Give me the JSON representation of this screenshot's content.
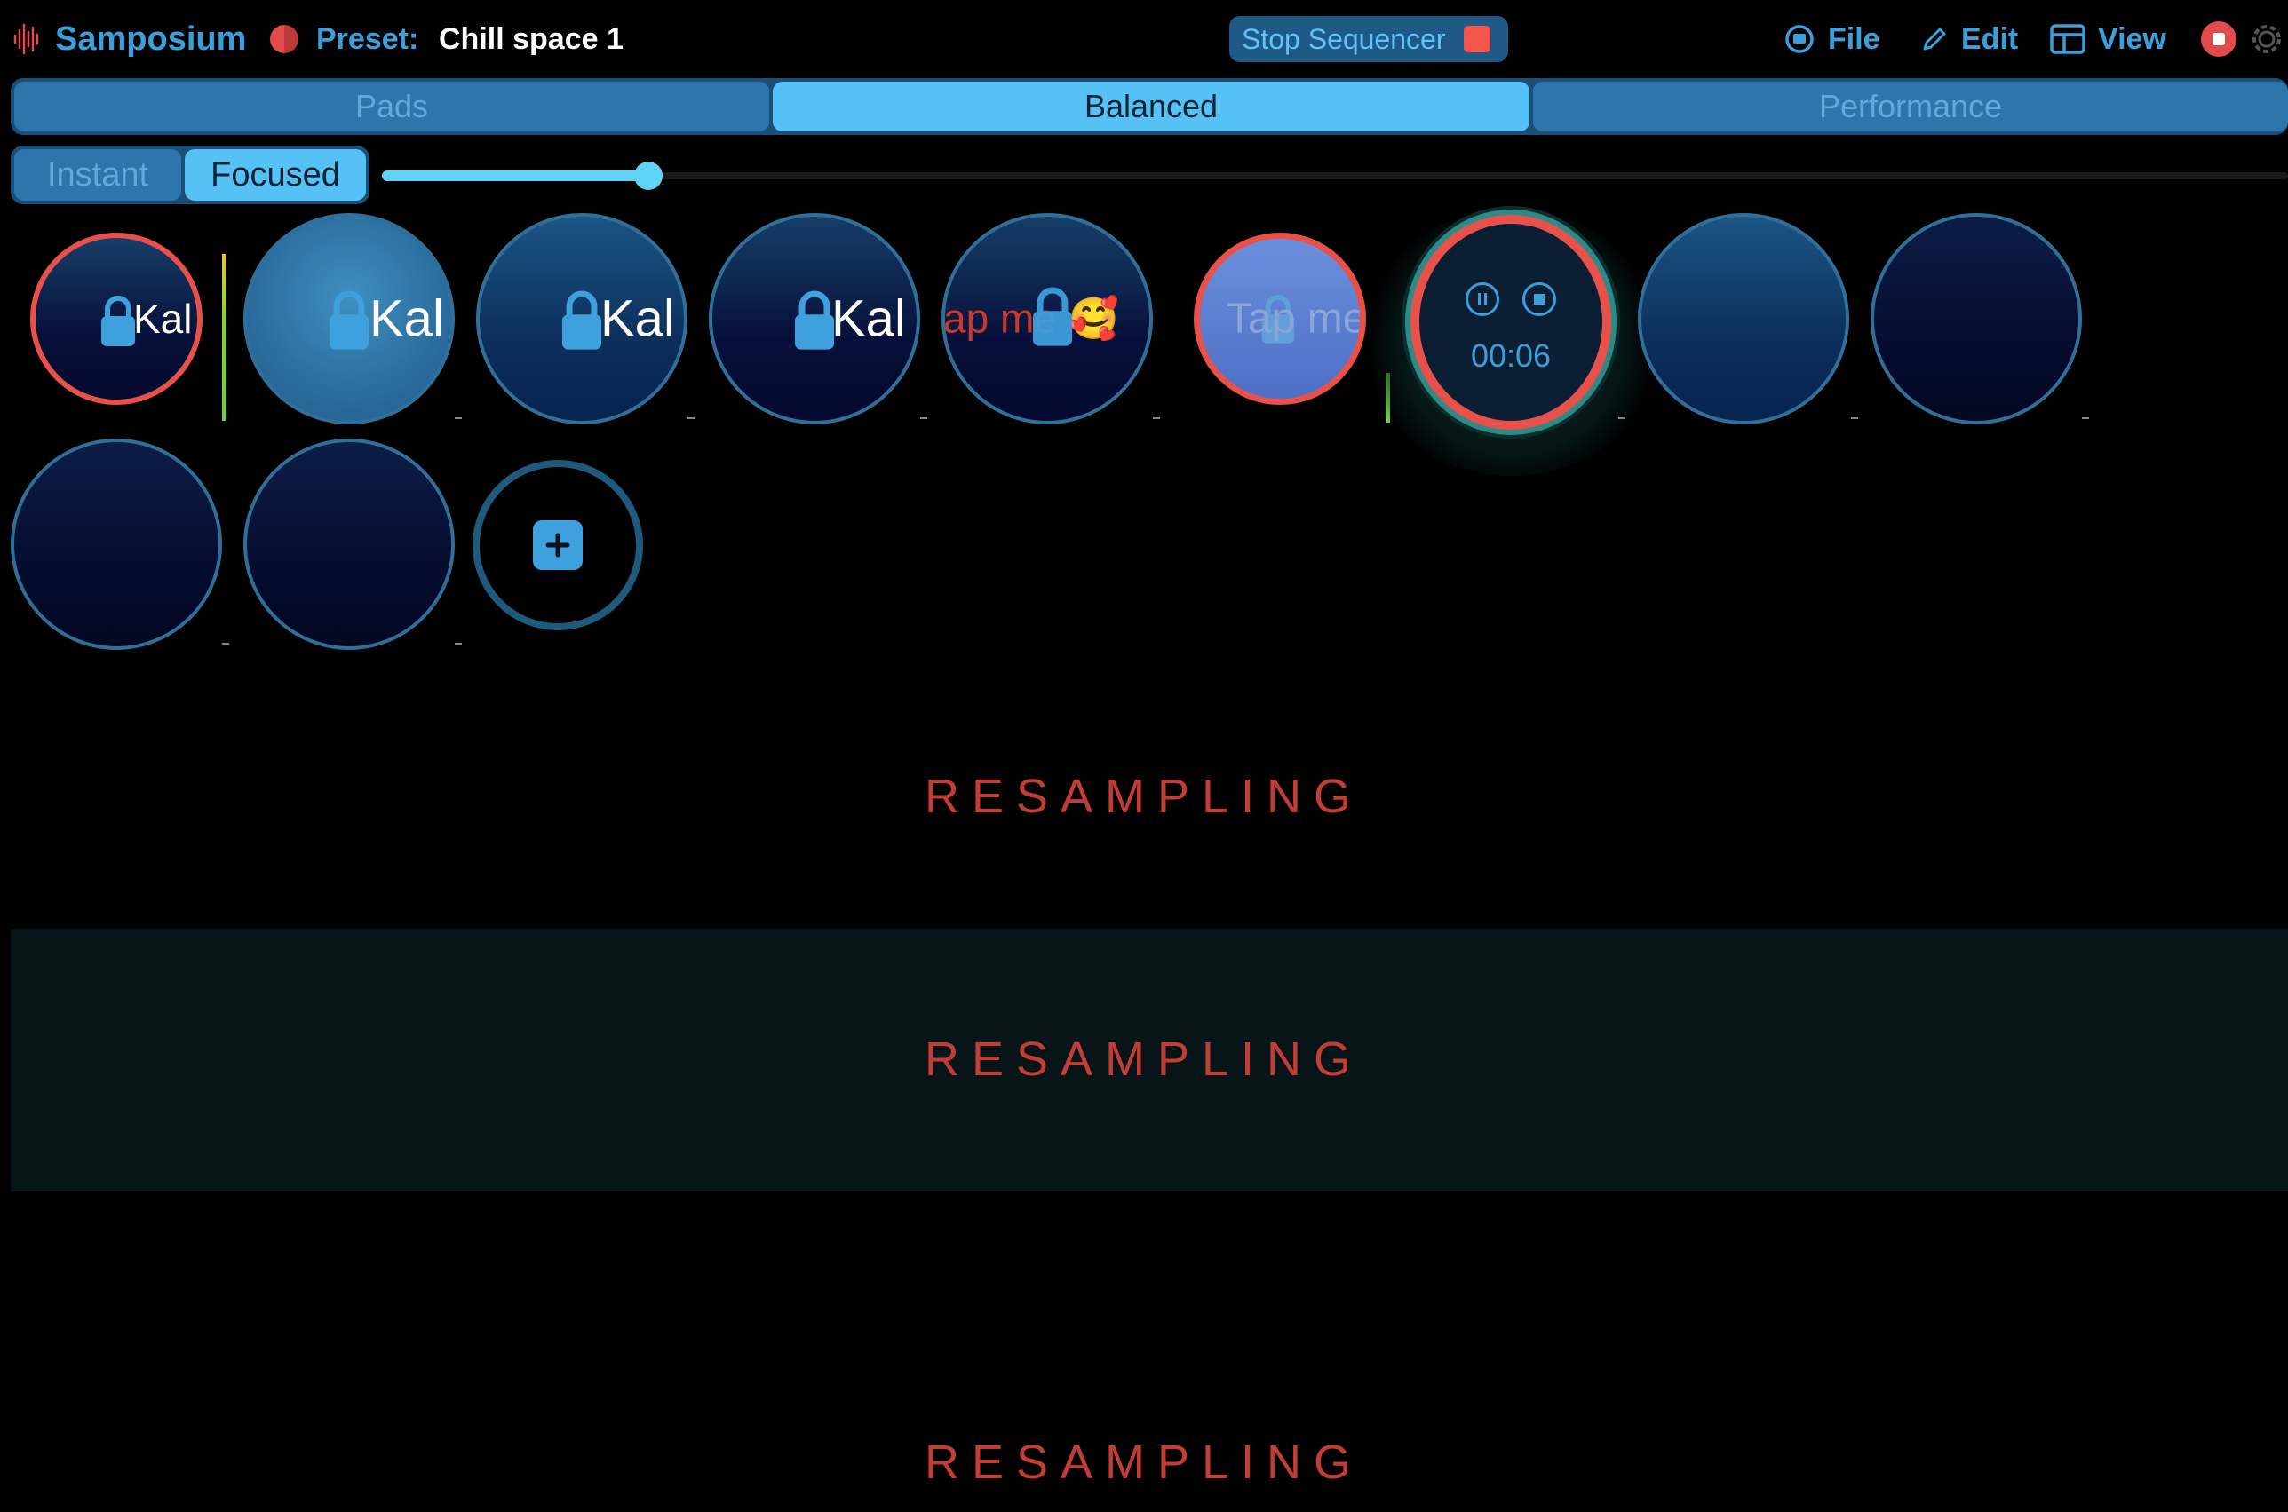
{
  "header": {
    "app_title": "Samposium",
    "preset_label": "Preset:",
    "preset_name": "Chill space 1",
    "stop_sequencer_label": "Stop Sequencer",
    "menu": [
      {
        "label": "File",
        "icon": "file-icon"
      },
      {
        "label": "Edit",
        "icon": "pencil-icon"
      },
      {
        "label": "View",
        "icon": "layout-icon"
      }
    ]
  },
  "tabs": [
    {
      "label": "Pads",
      "active": false
    },
    {
      "label": "Balanced",
      "active": true
    },
    {
      "label": "Performance",
      "active": false
    }
  ],
  "modes": [
    {
      "label": "Instant",
      "active": false
    },
    {
      "label": "Focused",
      "active": true
    }
  ],
  "slider": {
    "value": 0.14
  },
  "pads": {
    "labels": [
      "Kal",
      "Kal",
      "Kal",
      "Kal",
      "ap me 🥰",
      "Tap me"
    ],
    "active_timer": "00:06"
  },
  "resampling": [
    "RESAMPLING",
    "RESAMPLING",
    "RESAMPLING"
  ],
  "colors": {
    "accent": "#3b9fdc",
    "active_tab": "#56c1f4",
    "record_red": "#e8514a",
    "resampling_red": "#c43d35"
  }
}
